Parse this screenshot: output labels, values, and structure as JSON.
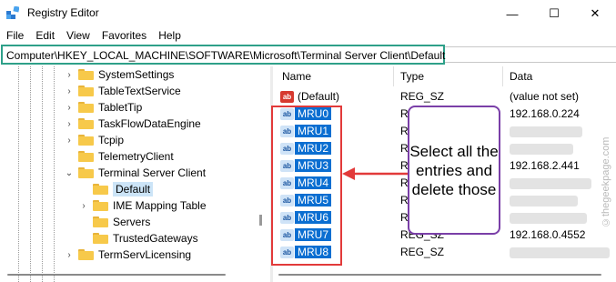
{
  "window": {
    "title": "Registry Editor",
    "minimize_glyph": "—",
    "maximize_glyph": "☐",
    "close_glyph": "✕"
  },
  "menu": [
    "File",
    "Edit",
    "View",
    "Favorites",
    "Help"
  ],
  "address": "Computer\\HKEY_LOCAL_MACHINE\\SOFTWARE\\Microsoft\\Terminal Server Client\\Default",
  "tree": {
    "items": [
      {
        "label": "SystemSettings",
        "chevron": "›"
      },
      {
        "label": "TableTextService",
        "chevron": "›"
      },
      {
        "label": "TabletTip",
        "chevron": "›"
      },
      {
        "label": "TaskFlowDataEngine",
        "chevron": "›"
      },
      {
        "label": "Tcpip",
        "chevron": "›"
      },
      {
        "label": "TelemetryClient",
        "chevron": ""
      },
      {
        "label": "Terminal Server Client",
        "chevron": "⌄"
      },
      {
        "label": "Default",
        "chevron": "",
        "selected": true
      },
      {
        "label": "IME Mapping Table",
        "chevron": "›"
      },
      {
        "label": "Servers",
        "chevron": ""
      },
      {
        "label": "TrustedGateways",
        "chevron": ""
      },
      {
        "label": "TermServLicensing",
        "chevron": "›"
      }
    ]
  },
  "list": {
    "columns": [
      "Name",
      "Type",
      "Data"
    ],
    "rows": [
      {
        "icon": "string-value-icon",
        "icon_text": "ab",
        "name": "(Default)",
        "type": "REG_SZ",
        "data": "(value not set)",
        "selected": false
      },
      {
        "icon": "string-value-icon",
        "icon_text": "ab",
        "name": "MRU0",
        "type": "REG_SZ",
        "data": "192.168.0.224",
        "selected": true
      },
      {
        "icon": "string-value-icon",
        "icon_text": "ab",
        "name": "MRU1",
        "type": "REG_SZ",
        "data": "",
        "selected": true
      },
      {
        "icon": "string-value-icon",
        "icon_text": "ab",
        "name": "MRU2",
        "type": "REG_SZ",
        "data": "",
        "selected": true
      },
      {
        "icon": "string-value-icon",
        "icon_text": "ab",
        "name": "MRU3",
        "type": "REG_SZ",
        "data": "192.168.2.441",
        "selected": true
      },
      {
        "icon": "string-value-icon",
        "icon_text": "ab",
        "name": "MRU4",
        "type": "REG_SZ",
        "data": "",
        "selected": true
      },
      {
        "icon": "string-value-icon",
        "icon_text": "ab",
        "name": "MRU5",
        "type": "REG_SZ",
        "data": "",
        "selected": true
      },
      {
        "icon": "string-value-icon",
        "icon_text": "ab",
        "name": "MRU6",
        "type": "REG_SZ",
        "data": "",
        "selected": true
      },
      {
        "icon": "string-value-icon",
        "icon_text": "ab",
        "name": "MRU7",
        "type": "REG_SZ",
        "data": "192.168.0.4552",
        "selected": true
      },
      {
        "icon": "string-value-icon",
        "icon_text": "ab",
        "name": "MRU8",
        "type": "REG_SZ",
        "data": "",
        "selected": true
      }
    ]
  },
  "callout": "Select all the entries and delete those",
  "watermark": "©thegeekpage.com",
  "colors": {
    "address_border": "#2ea089",
    "selection": "#0a6ed1",
    "highlight_box": "#e23a3a",
    "callout_border": "#7a3fa8"
  }
}
